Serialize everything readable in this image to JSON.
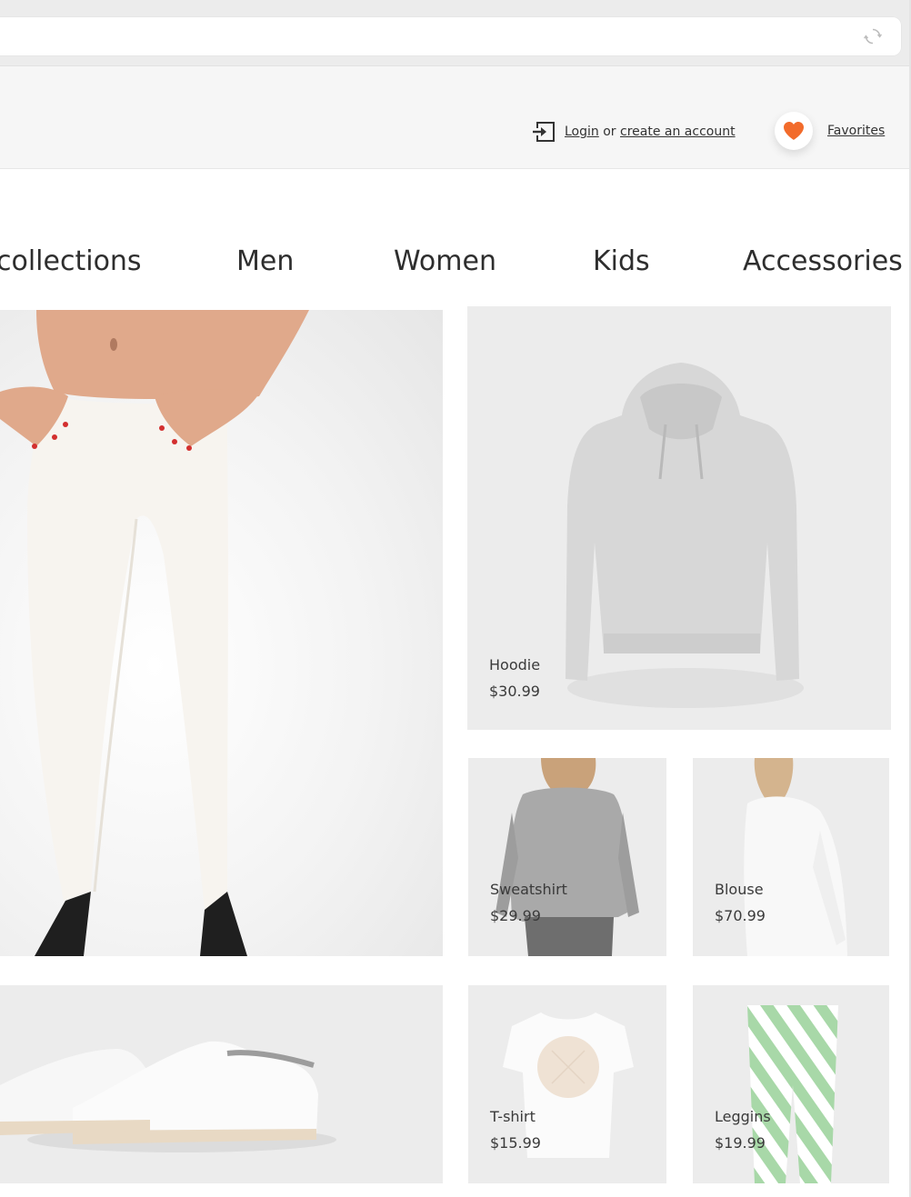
{
  "header": {
    "login_text": "Login",
    "or_text": "or",
    "create_account_text": "create an account",
    "favorites_label": "Favorites"
  },
  "nav": {
    "items": [
      "collections",
      "Men",
      "Women",
      "Kids",
      "Accessories"
    ]
  },
  "products": [
    {
      "name": "Hoodie",
      "price": "$30.99"
    },
    {
      "name": "Sweatshirt",
      "price": "$29.99"
    },
    {
      "name": "Blouse",
      "price": "$70.99"
    },
    {
      "name": "T-shirt",
      "price": "$15.99"
    },
    {
      "name": "Leggins",
      "price": "$19.99"
    }
  ],
  "colors": {
    "accent": "#f26b2b",
    "chrome": "#ececec",
    "header_bg": "#f6f6f6",
    "card_bg": "#ececec",
    "stripe_green": "#a8d8a8"
  },
  "icons": {
    "reload": "reload-icon",
    "login": "login-arrow-icon",
    "favorites": "heart-icon"
  }
}
